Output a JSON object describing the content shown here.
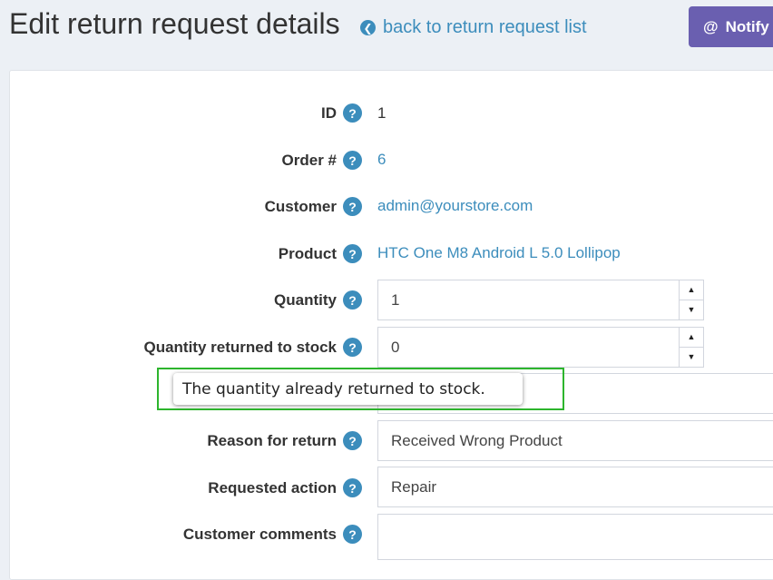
{
  "header": {
    "title": "Edit return request details",
    "back_link": "back to return request list",
    "notify_button": "Notify"
  },
  "form": {
    "id": {
      "label": "ID",
      "value": "1"
    },
    "order": {
      "label": "Order #",
      "value": "6"
    },
    "customer": {
      "label": "Customer",
      "value": "admin@yourstore.com"
    },
    "product": {
      "label": "Product",
      "value": "HTC One M8 Android L 5.0 Lollipop"
    },
    "quantity": {
      "label": "Quantity",
      "value": "1"
    },
    "quantity_returned": {
      "label": "Quantity returned to stock",
      "value": "0"
    },
    "reason": {
      "label": "Reason for return",
      "value": "Received Wrong Product"
    },
    "action": {
      "label": "Requested action",
      "value": "Repair"
    },
    "comments": {
      "label": "Customer comments",
      "value": ""
    }
  },
  "tooltip": {
    "text": "The quantity already returned to stock."
  },
  "icons": {
    "help": "question-circle-icon",
    "back": "arrow-circle-left-icon",
    "notify": "at-icon"
  },
  "colors": {
    "link": "#3c8dbc",
    "notify_button": "#6a5fb0",
    "highlight_frame": "#2db52d"
  }
}
